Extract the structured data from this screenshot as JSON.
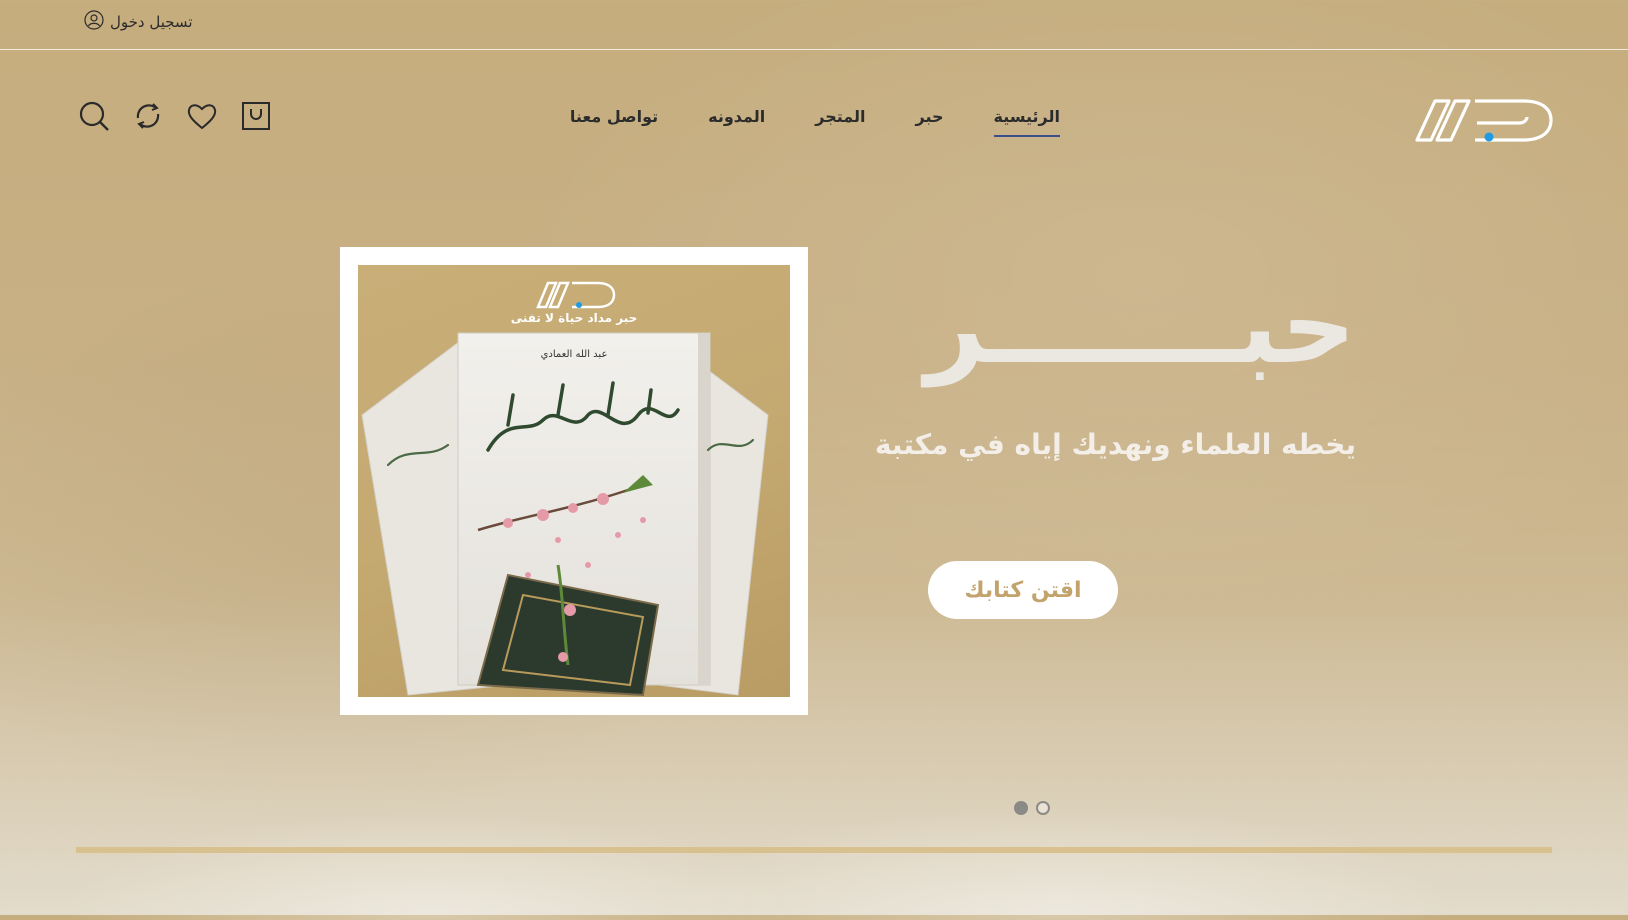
{
  "topbar": {
    "login_label": "تسجيل دخول",
    "login_icon": "user-circle-icon"
  },
  "nav": {
    "items": [
      {
        "label": "الرئيسية",
        "active": true
      },
      {
        "label": "حبر",
        "active": false
      },
      {
        "label": "المتجر",
        "active": false
      },
      {
        "label": "المدونه",
        "active": false
      },
      {
        "label": "تواصل معنا",
        "active": false
      }
    ]
  },
  "header_icons": [
    "search-icon",
    "refresh-icon",
    "heart-icon",
    "cart-icon"
  ],
  "hero": {
    "title": "حبـــــــر",
    "subtitle": "يخطه العلماء ونهديك إياه في مكتبة",
    "cta_label": "اقتن كتابك",
    "image": {
      "brand_tagline": "حبر مداد حياة لا تفنى",
      "author": "عبد الله العمادي",
      "book_title": "وضرب الله مثلا"
    }
  },
  "slider": {
    "count": 2,
    "active_index": 0
  },
  "colors": {
    "accent": "#c2a36c",
    "nav_active_underline": "#3a4f8a",
    "logo_dot": "#1e9be3",
    "divider": "#d8c18e"
  }
}
